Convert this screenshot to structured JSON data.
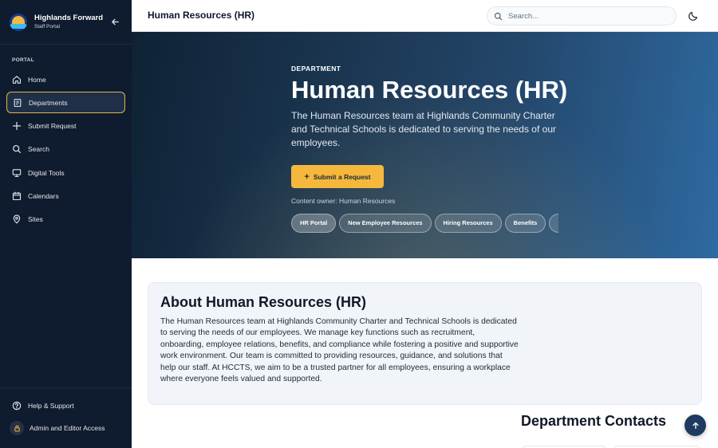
{
  "brand": {
    "name": "Highlands Forward",
    "subtitle": "Staff Portal"
  },
  "sidebar": {
    "section_label": "PORTAL",
    "items": [
      {
        "label": "Home",
        "icon": "home-icon"
      },
      {
        "label": "Departments",
        "icon": "building-icon",
        "active": true
      },
      {
        "label": "Submit Request",
        "icon": "plus-icon"
      },
      {
        "label": "Search",
        "icon": "search-icon"
      },
      {
        "label": "Digital Tools",
        "icon": "monitor-icon"
      },
      {
        "label": "Calendars",
        "icon": "calendar-icon"
      },
      {
        "label": "Sites",
        "icon": "map-pin-icon"
      }
    ],
    "bottom": {
      "help_label": "Help & Support",
      "admin_label": "Admin and Editor Access"
    }
  },
  "header": {
    "title": "Human Resources (HR)",
    "search_placeholder": "Search..."
  },
  "hero": {
    "eyebrow": "DEPARTMENT",
    "title": "Human Resources (HR)",
    "description": "The Human Resources team at Highlands Community Charter and Technical Schools is dedicated to serving the needs of our employees.",
    "submit_label": "Submit a Request",
    "owner": "Content owner: Human Resources",
    "chips": [
      "HR Portal",
      "New Employee Resources",
      "Hiring Resources",
      "Benefits",
      ""
    ]
  },
  "about": {
    "title": "About Human Resources (HR)",
    "body": "The Human Resources team at Highlands Community Charter and Technical Schools is dedicated to serving the needs of our employees. We manage key functions such as recruitment, onboarding, employee relations, benefits, and compliance while fostering a positive and supportive work environment. Our team is committed to providing resources, guidance, and solutions that help our staff. At HCCTS, we aim to be a trusted partner for all employees, ensuring a workplace where everyone feels valued and supported."
  },
  "contacts": {
    "title": "Department Contacts"
  },
  "colors": {
    "sidebar_bg": "#0f1b2e",
    "accent": "#f5b83d",
    "hero_dark": "#0f2235",
    "hero_light": "#2f6aa2",
    "fab": "#1e3a5f"
  }
}
